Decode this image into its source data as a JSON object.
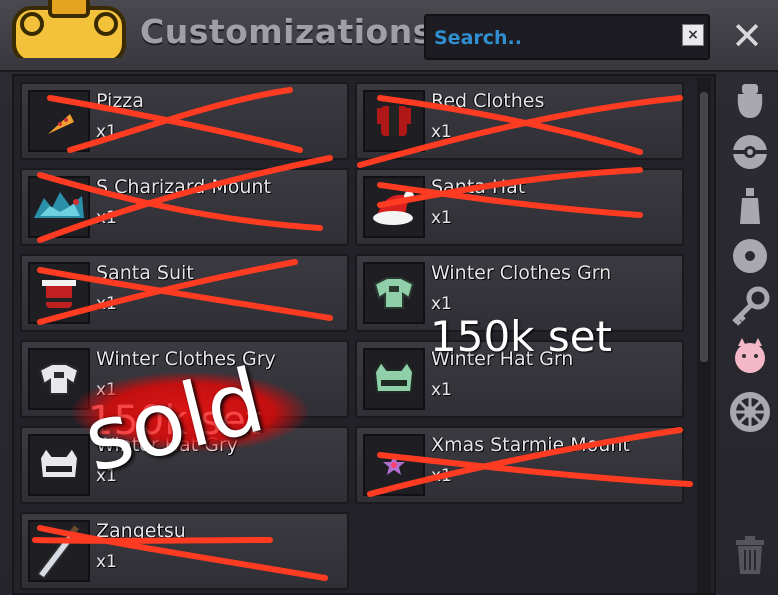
{
  "title": "Customizations",
  "search": {
    "placeholder": "Search..",
    "clear_label": "×"
  },
  "close_label": "✕",
  "items": [
    {
      "name": "Pizza",
      "qty": "x1",
      "icon": "pizza-icon",
      "crossed": true
    },
    {
      "name": "Red Clothes",
      "qty": "x1",
      "icon": "red-clothes-icon",
      "crossed": true
    },
    {
      "name": "S Charizard Mount",
      "qty": "x1",
      "icon": "charizard-mount-icon",
      "crossed": true
    },
    {
      "name": "Santa Hat",
      "qty": "x1",
      "icon": "santa-hat-icon",
      "crossed": true
    },
    {
      "name": "Santa Suit",
      "qty": "x1",
      "icon": "santa-suit-icon",
      "crossed": true
    },
    {
      "name": "Winter Clothes Grn",
      "qty": "x1",
      "icon": "winter-clothes-green-icon",
      "crossed": false
    },
    {
      "name": "Winter Clothes Gry",
      "qty": "x1",
      "icon": "winter-clothes-gray-icon",
      "crossed": false
    },
    {
      "name": "Winter Hat Grn",
      "qty": "x1",
      "icon": "winter-hat-green-icon",
      "crossed": false
    },
    {
      "name": "Winter Hat Gry",
      "qty": "x1",
      "icon": "winter-hat-gray-icon",
      "crossed": false
    },
    {
      "name": "Xmas Starmie Mount",
      "qty": "x1",
      "icon": "starmie-mount-icon",
      "crossed": true
    },
    {
      "name": "Zangetsu",
      "qty": "x1",
      "icon": "zangetsu-sword-icon",
      "crossed": true
    }
  ],
  "sidebar": [
    {
      "icon": "bag-icon"
    },
    {
      "icon": "pokeball-icon"
    },
    {
      "icon": "bottle-icon"
    },
    {
      "icon": "disc-icon"
    },
    {
      "icon": "key-icon"
    },
    {
      "icon": "clefairy-icon"
    },
    {
      "icon": "wheel-icon"
    },
    {
      "icon": "trash-icon"
    }
  ],
  "annotations": {
    "price": "150k set",
    "sold": "sold",
    "sold_hidden": "150k set"
  },
  "colors": {
    "accent": "#2f8fd0",
    "cross": "#ff3b22",
    "title": "#9f9fa8"
  }
}
